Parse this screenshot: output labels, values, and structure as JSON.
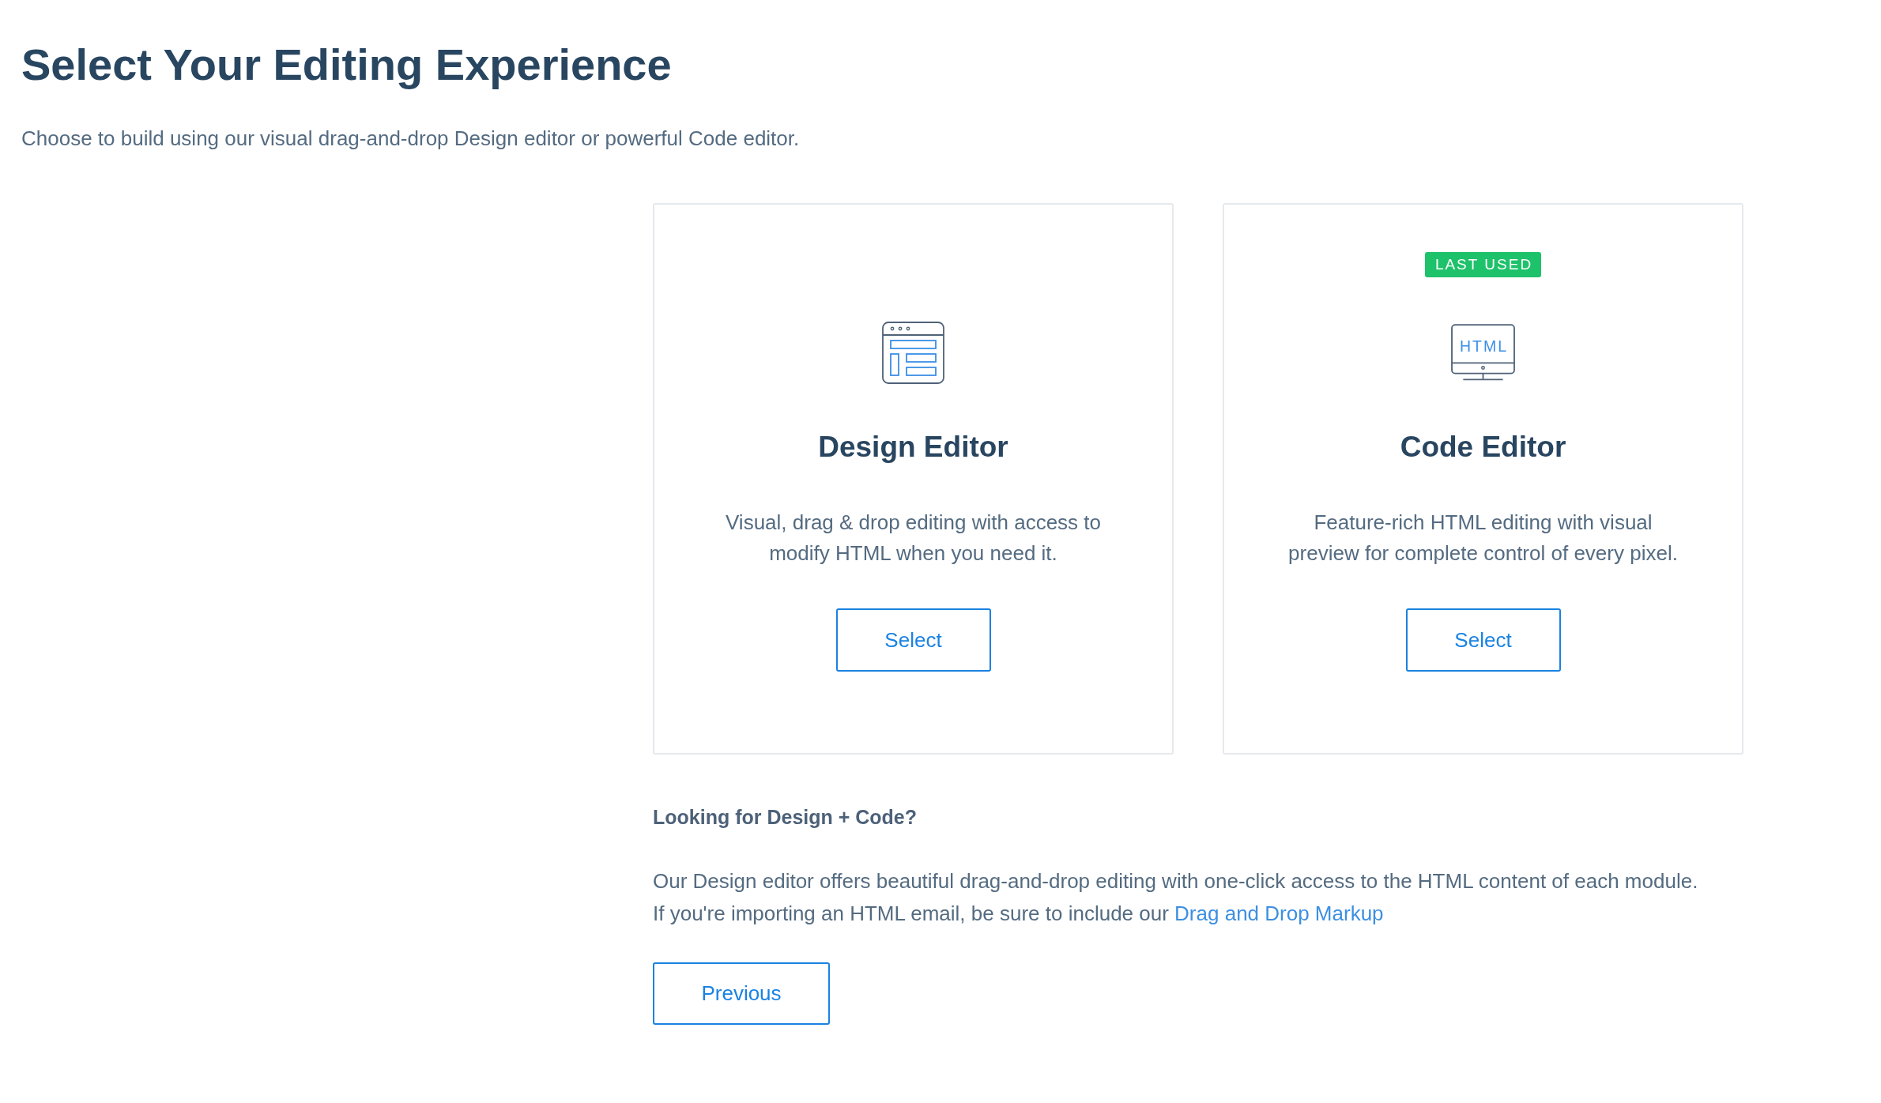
{
  "page": {
    "title": "Select Your Editing Experience",
    "subtitle": "Choose to build using our visual drag-and-drop Design editor or powerful Code editor."
  },
  "editors": [
    {
      "kind": "design",
      "title": "Design Editor",
      "description": "Visual, drag & drop editing with access to modify HTML when you need it.",
      "button": "Select"
    },
    {
      "kind": "code",
      "badge": "LAST USED",
      "icon_text": "HTML",
      "title": "Code Editor",
      "description": "Feature-rich HTML editing with visual preview for complete control of every pixel.",
      "button": "Select"
    }
  ],
  "info": {
    "heading": "Looking for Design + Code?",
    "text": "Our Design editor offers beautiful drag-and-drop editing with one-click access to the HTML content of each module.\nIf you're importing an HTML email, be sure to include our ",
    "link": "Drag and Drop Markup"
  },
  "previous_button": "Previous"
}
